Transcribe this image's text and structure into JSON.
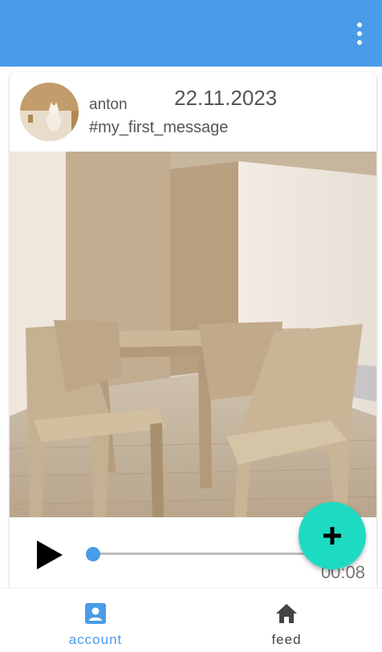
{
  "app_bar": {
    "color": "#4a9be8",
    "menu_icon": "more-vert-icon"
  },
  "post": {
    "username": "anton",
    "date": "22.11.2023",
    "hashtag": "#my_first_message",
    "image_subject": "wooden table and chairs",
    "player": {
      "state": "paused",
      "progress": 0.0,
      "time": "00:08"
    }
  },
  "fab": {
    "icon": "plus-icon",
    "color": "#1ddbc2"
  },
  "bottom_nav": {
    "items": [
      {
        "label": "account",
        "icon": "account-box-icon",
        "active": true,
        "color": "#4a9be8"
      },
      {
        "label": "feed",
        "icon": "home-icon",
        "active": false,
        "color": "#444444"
      }
    ]
  }
}
